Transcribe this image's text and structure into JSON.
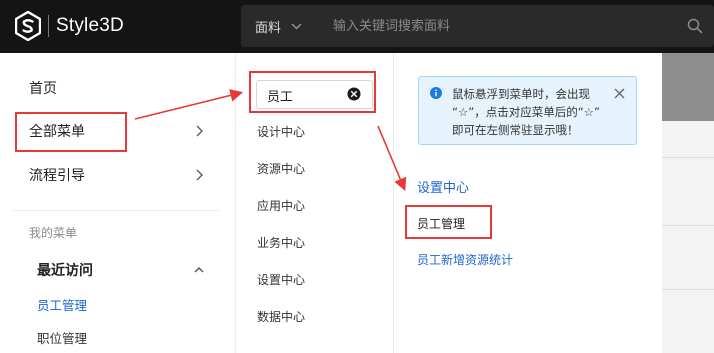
{
  "header": {
    "brand": "Style3D",
    "search_category": "面料",
    "search_placeholder": "输入关键词搜索面料"
  },
  "sidebar": {
    "items": [
      {
        "label": "首页"
      },
      {
        "label": "全部菜单"
      },
      {
        "label": "流程引导"
      }
    ],
    "my_menu_label": "我的菜单",
    "recent_label": "最近访问",
    "recent_items": [
      {
        "label": "员工管理",
        "active": true
      },
      {
        "label": "职位管理",
        "active": false
      }
    ]
  },
  "menu_search": {
    "value": "员工"
  },
  "categories": [
    {
      "label": "设计中心"
    },
    {
      "label": "资源中心"
    },
    {
      "label": "应用中心"
    },
    {
      "label": "业务中心"
    },
    {
      "label": "设置中心"
    },
    {
      "label": "数据中心"
    }
  ],
  "tip": {
    "line1": "鼠标悬浮到菜单时，会出现",
    "line2": "“☆”，点击对应菜单后的“☆”",
    "line3": "即可在左侧常驻显示哦！"
  },
  "results": {
    "group_title": "设置中心",
    "items": [
      {
        "label": "员工管理"
      },
      {
        "label": "员工新增资源统计"
      }
    ]
  },
  "colors": {
    "topbar": "#141414",
    "accent_blue": "#1e66d0",
    "annotation_red": "#e53935",
    "tip_bg": "#e6f3fc"
  }
}
